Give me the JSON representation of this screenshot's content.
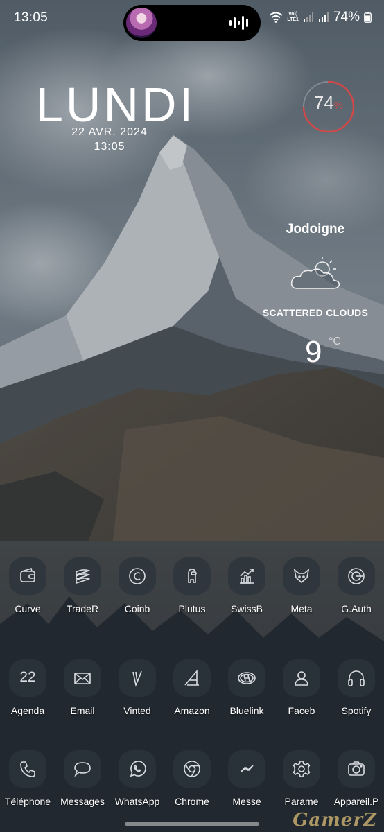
{
  "status_bar": {
    "time": "13:05",
    "network": "LTE1",
    "volte": "Vo))",
    "battery": "74%"
  },
  "clock_widget": {
    "day": "LUNDI",
    "date": "22 AVR. 2024",
    "time": "13:05"
  },
  "battery_widget": {
    "value": "74",
    "unit": "%",
    "level": 0.74,
    "accent_color": "#d04848"
  },
  "weather_widget": {
    "city": "Jodoigne",
    "condition": "SCATTERED CLOUDS",
    "temperature": "9",
    "unit": "°C",
    "icon": "partly-cloudy-icon"
  },
  "apps": {
    "row1": [
      {
        "label": "Curve",
        "icon": "wallet-icon"
      },
      {
        "label": "TradeR",
        "icon": "layers-icon"
      },
      {
        "label": "Coinb",
        "icon": "coin-icon"
      },
      {
        "label": "Plutus",
        "icon": "astronaut-icon"
      },
      {
        "label": "SwissB",
        "icon": "chart-up-icon"
      },
      {
        "label": "Meta",
        "icon": "fox-icon"
      },
      {
        "label": "G.Auth",
        "icon": "authenticator-icon"
      }
    ],
    "row2": [
      {
        "label": "Agenda",
        "icon": "calendar-icon",
        "badge": "22"
      },
      {
        "label": "Email",
        "icon": "envelope-icon"
      },
      {
        "label": "Vinted",
        "icon": "vinted-icon"
      },
      {
        "label": "Amazon",
        "icon": "amazon-icon"
      },
      {
        "label": "Bluelink",
        "icon": "hyundai-icon"
      },
      {
        "label": "Faceb",
        "icon": "person-icon"
      },
      {
        "label": "Spotify",
        "icon": "headphones-icon"
      }
    ],
    "row3": [
      {
        "label": "Téléphone",
        "icon": "phone-icon"
      },
      {
        "label": "Messages",
        "icon": "chat-bubble-icon"
      },
      {
        "label": "WhatsApp",
        "icon": "whatsapp-icon"
      },
      {
        "label": "Chrome",
        "icon": "chrome-icon"
      },
      {
        "label": "Messe",
        "icon": "messenger-icon"
      },
      {
        "label": "Parame",
        "icon": "gear-icon"
      },
      {
        "label": "Appareil.P",
        "icon": "camera-icon"
      }
    ]
  },
  "watermark": "GamerZ"
}
